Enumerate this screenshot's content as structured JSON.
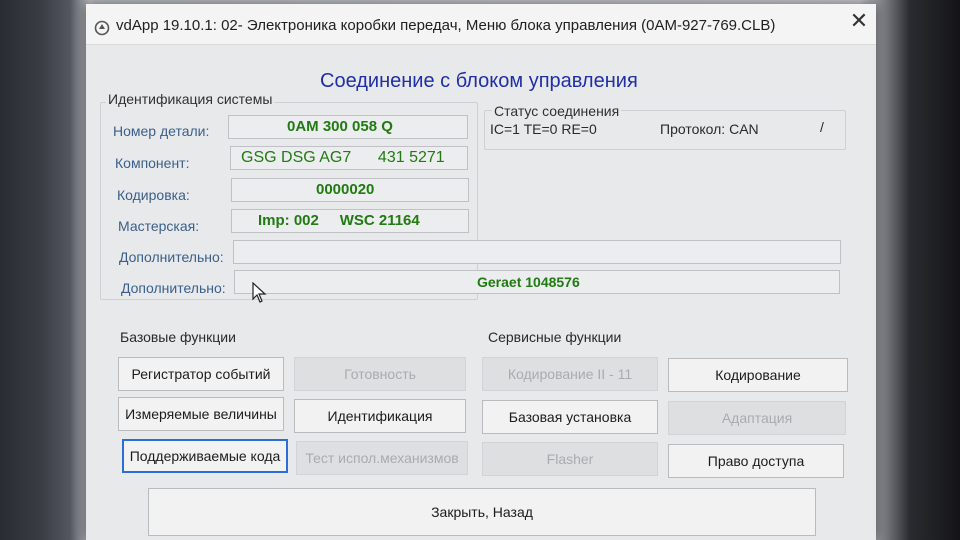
{
  "window": {
    "title": "vdApp 19.10.1: 02- Электроника коробки передач,  Меню блока управления (0AM-927-769.CLB)",
    "close_symbol": "✕",
    "icon": "vdapp-logo-icon"
  },
  "header": {
    "title": "Соединение с блоком управления"
  },
  "identification": {
    "group_label": "Идентификация системы",
    "fields": [
      {
        "label": "Номер детали:",
        "value": "0AM 300 058 Q"
      },
      {
        "label": "Компонент:",
        "value": "GSG DSG AG7      431 5271"
      },
      {
        "label": "Кодировка:",
        "value": "0000020"
      },
      {
        "label": "Мастерская:",
        "value": "Imp: 002     WSC 21164"
      },
      {
        "label": "Дополнительно:",
        "value": ""
      },
      {
        "label": "Дополнительно:",
        "value": "Geraet 1048576"
      }
    ]
  },
  "connection_status": {
    "group_label": "Статус соединения",
    "counters": "IC=1  TE=0   RE=0",
    "protocol": "Протокол: CAN",
    "activity": "/"
  },
  "basic_functions": {
    "label": "Базовые функции",
    "buttons": [
      {
        "label": "Регистратор событий",
        "enabled": true
      },
      {
        "label": "Готовность",
        "enabled": false
      },
      {
        "label": "Измеряемые величины",
        "enabled": true
      },
      {
        "label": "Идентификация",
        "enabled": true
      },
      {
        "label": "Поддерживаемые кода",
        "enabled": true,
        "focused": true
      },
      {
        "label": "Тест испол.механизмов",
        "enabled": false
      }
    ]
  },
  "service_functions": {
    "label": "Сервисные функции",
    "buttons": [
      {
        "label": "Кодирование II - 11",
        "enabled": false
      },
      {
        "label": "Кодирование",
        "enabled": true
      },
      {
        "label": "Базовая установка",
        "enabled": true
      },
      {
        "label": "Адаптация",
        "enabled": false
      },
      {
        "label": "Flasher",
        "enabled": false
      },
      {
        "label": "Право доступа",
        "enabled": true
      }
    ]
  },
  "footer": {
    "close_label": "Закрыть, Назад"
  },
  "colors": {
    "title_blue": "#1f2fa6",
    "value_green": "#217a12",
    "label_blue": "#3a5f8a",
    "focus_blue": "#2b6ed6"
  }
}
